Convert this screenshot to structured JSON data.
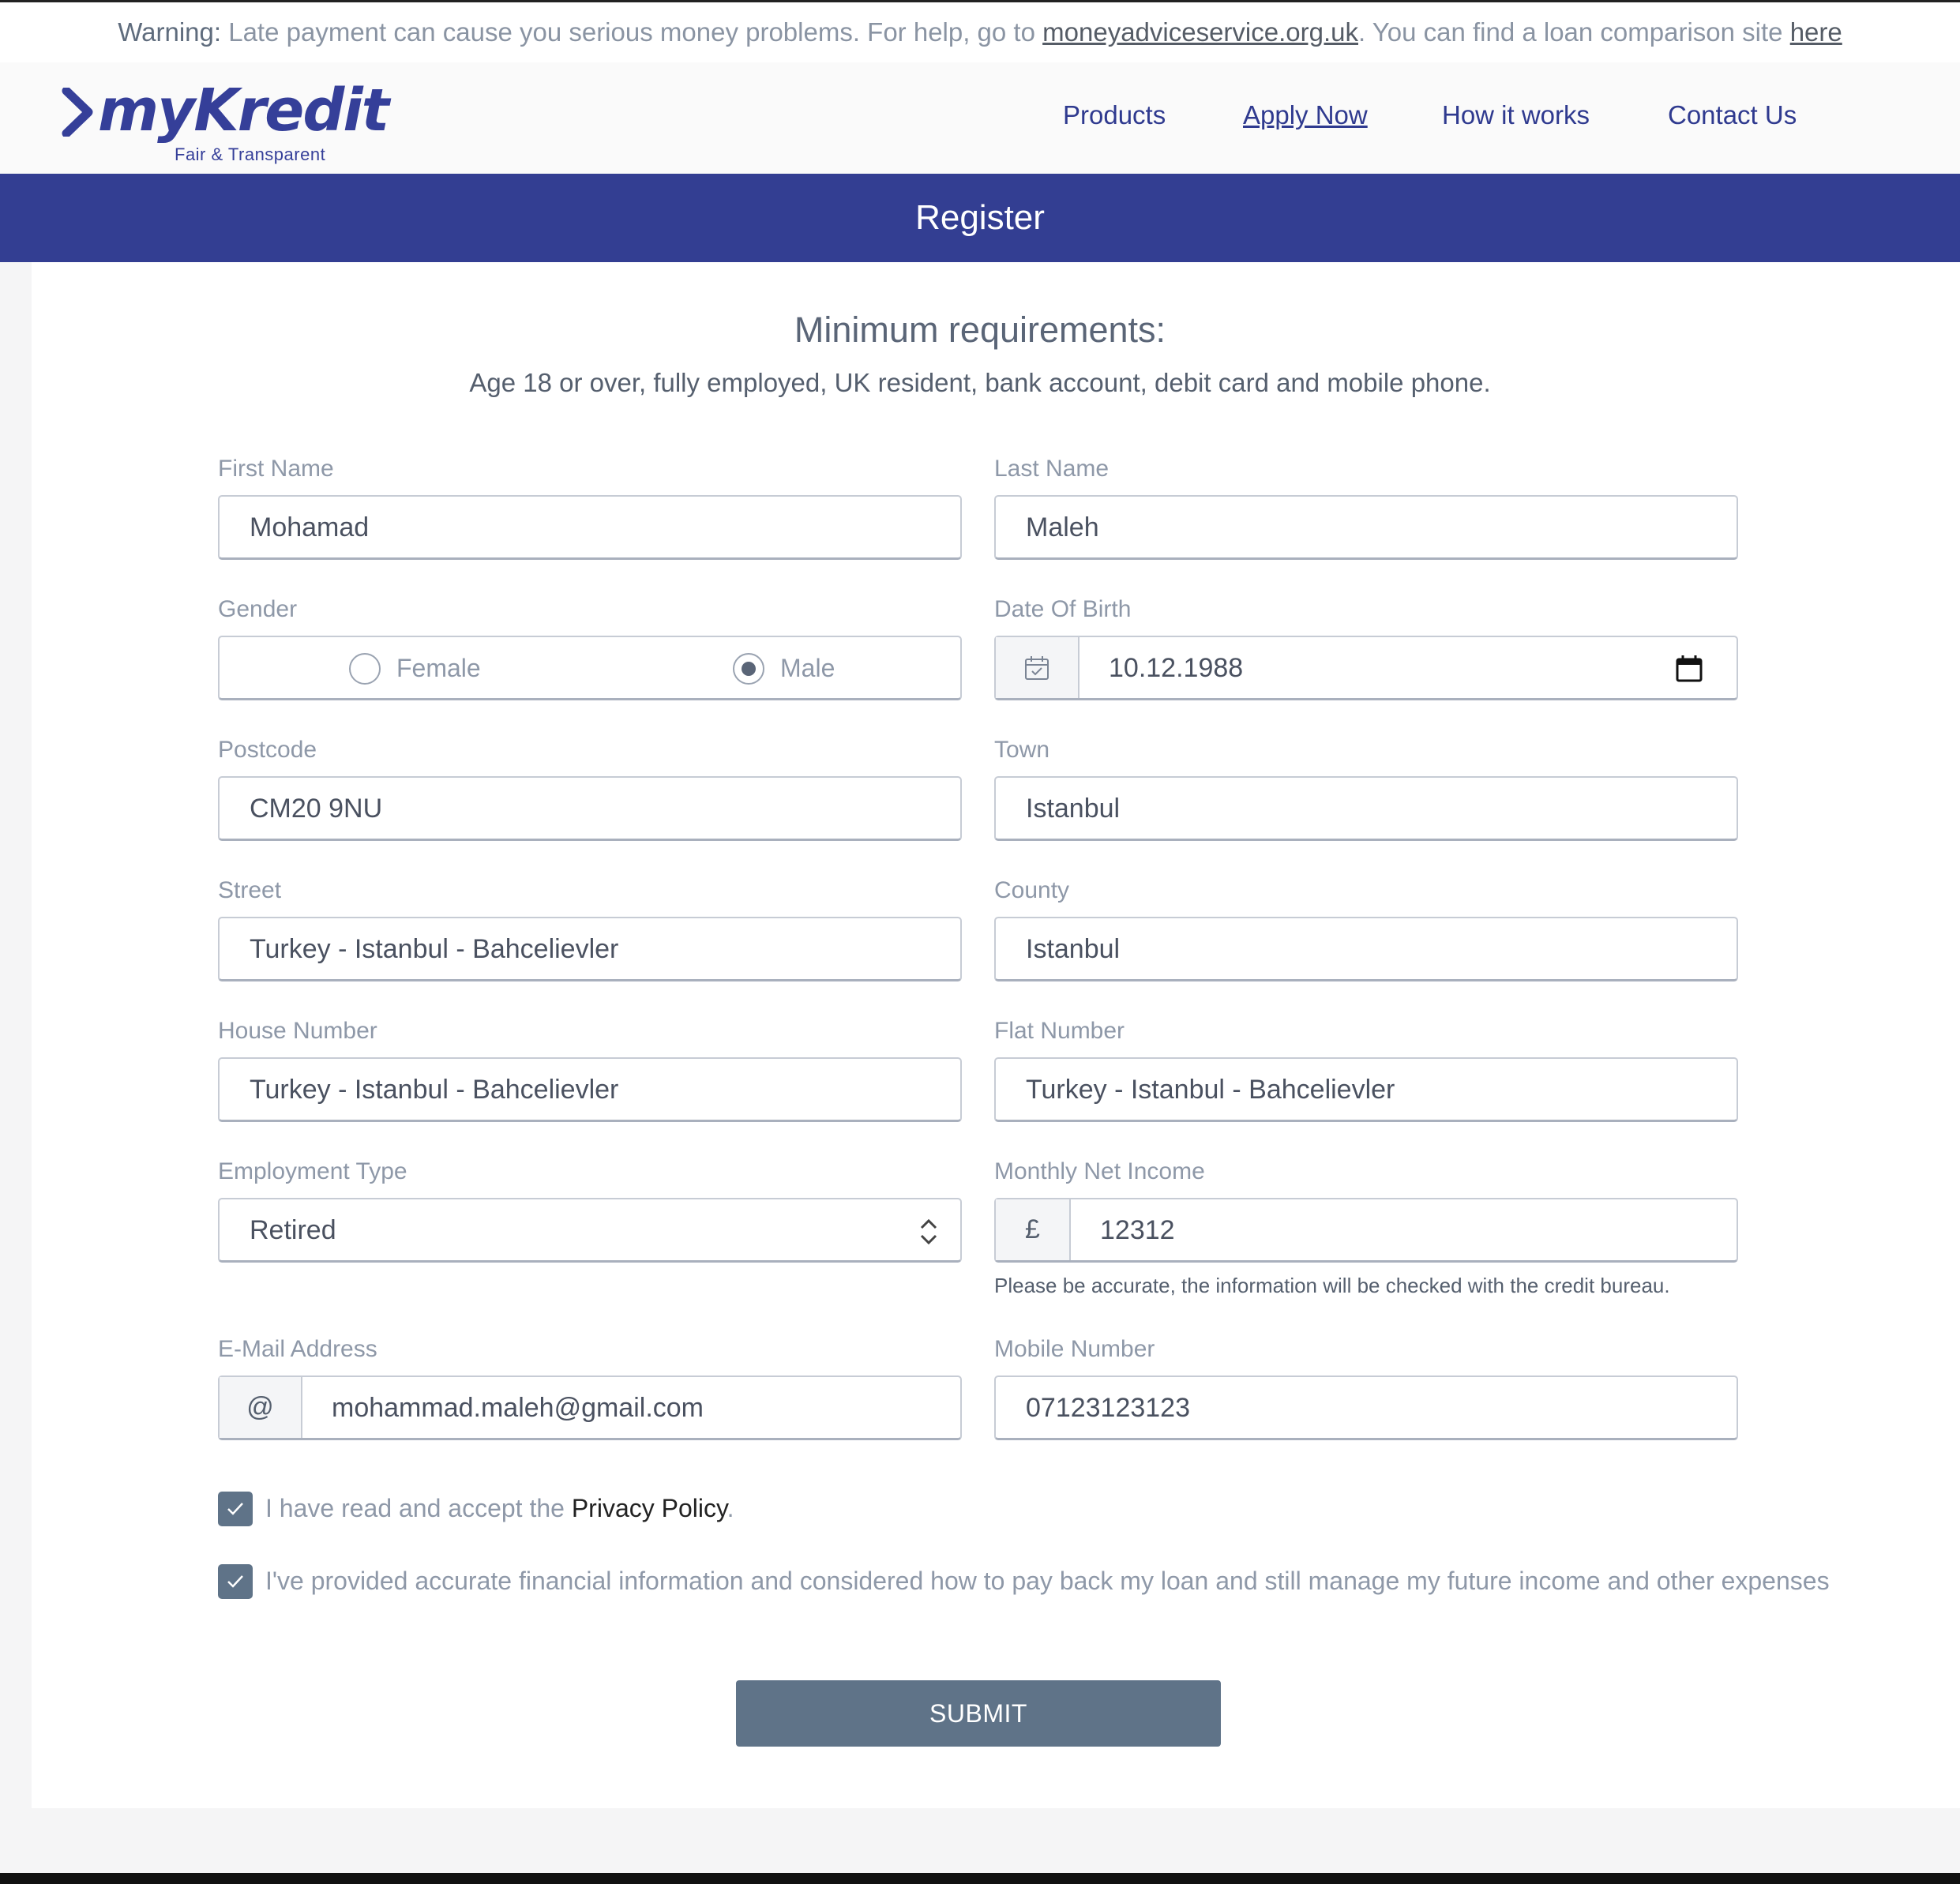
{
  "warning": {
    "prefix": "Warning:",
    "text1": " Late payment can cause you serious money problems. For help, go to ",
    "link1": "moneyadviceservice.org.uk",
    "text2": ". You can find a loan comparison site ",
    "link2": "here"
  },
  "brand": {
    "name": "myKredit",
    "tagline": "Fair & Transparent",
    "color": "#353f99"
  },
  "nav": {
    "products": "Products",
    "apply": "Apply Now",
    "how": "How it works",
    "contact": "Contact Us"
  },
  "banner": {
    "title": "Register",
    "color": "#333e92"
  },
  "requirements": {
    "title": "Minimum requirements:",
    "text": "Age 18 or over, fully employed, UK resident, bank account, debit card and mobile phone."
  },
  "form": {
    "first_name": {
      "label": "First Name",
      "value": "Mohamad"
    },
    "last_name": {
      "label": "Last Name",
      "value": "Maleh"
    },
    "gender": {
      "label": "Gender",
      "female": "Female",
      "male": "Male",
      "selected": "Male"
    },
    "dob": {
      "label": "Date Of Birth",
      "value": "10.12.1988",
      "icon": "calendar-icon"
    },
    "postcode": {
      "label": "Postcode",
      "value": "CM20 9NU"
    },
    "town": {
      "label": "Town",
      "value": "Istanbul"
    },
    "street": {
      "label": "Street",
      "value": "Turkey - Istanbul - Bahcelievler"
    },
    "county": {
      "label": "County",
      "value": "Istanbul"
    },
    "house_number": {
      "label": "House Number",
      "value": "Turkey - Istanbul - Bahcelievler"
    },
    "flat_number": {
      "label": "Flat Number",
      "value": "Turkey - Istanbul - Bahcelievler"
    },
    "employment": {
      "label": "Employment Type",
      "value": "Retired"
    },
    "income": {
      "label": "Monthly Net Income",
      "currency": "£",
      "value": "12312",
      "helper": "Please be accurate, the information will be checked with the credit bureau."
    },
    "email": {
      "label": "E-Mail Address",
      "addon": "@",
      "value": "mohammad.maleh@gmail.com"
    },
    "mobile": {
      "label": "Mobile Number",
      "value": "07123123123"
    },
    "privacy": {
      "text": "I have read and accept the ",
      "link": "Privacy Policy",
      "suffix": ".",
      "checked": true
    },
    "accuracy": {
      "text": "I've provided accurate financial information and considered how to pay back my loan and still manage my future income and other expenses",
      "checked": true
    },
    "submit": "SUBMIT"
  },
  "colors": {
    "button": "#5f7388",
    "text": "#444d5c",
    "label": "#8e98a8"
  }
}
